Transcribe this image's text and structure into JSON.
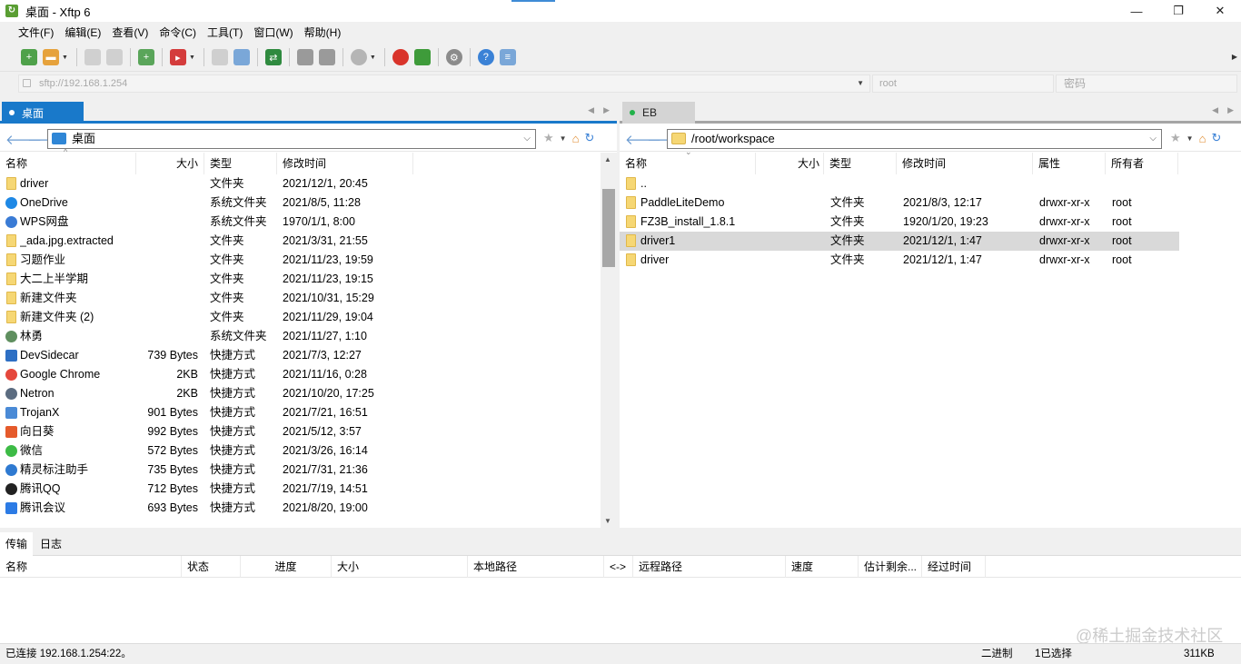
{
  "window": {
    "title": "桌面 - Xftp 6",
    "app_icon": "xftp-logo-icon"
  },
  "menu": [
    "文件(F)",
    "编辑(E)",
    "查看(V)",
    "命令(C)",
    "工具(T)",
    "窗口(W)",
    "帮助(H)"
  ],
  "address": {
    "host_placeholder": "sftp://192.168.1.254",
    "user_placeholder": "root",
    "password_placeholder": "密码"
  },
  "left": {
    "tab_label": "桌面",
    "path": "桌面",
    "columns": [
      "名称",
      "大小",
      "类型",
      "修改时间"
    ],
    "rows": [
      {
        "name": "driver",
        "size": "",
        "type": "文件夹",
        "modified": "2021/12/1, 20:45",
        "icon": "folder"
      },
      {
        "name": "OneDrive",
        "size": "",
        "type": "系统文件夹",
        "modified": "2021/8/5, 11:28",
        "icon": "cloud"
      },
      {
        "name": "WPS网盘",
        "size": "",
        "type": "系统文件夹",
        "modified": "1970/1/1, 8:00",
        "icon": "wps-cloud"
      },
      {
        "name": "_ada.jpg.extracted",
        "size": "",
        "type": "文件夹",
        "modified": "2021/3/31, 21:55",
        "icon": "folder"
      },
      {
        "name": "习题作业",
        "size": "",
        "type": "文件夹",
        "modified": "2021/11/23, 19:59",
        "icon": "folder"
      },
      {
        "name": "大二上半学期",
        "size": "",
        "type": "文件夹",
        "modified": "2021/11/23, 19:15",
        "icon": "folder"
      },
      {
        "name": "新建文件夹",
        "size": "",
        "type": "文件夹",
        "modified": "2021/10/31, 15:29",
        "icon": "folder"
      },
      {
        "name": "新建文件夹 (2)",
        "size": "",
        "type": "文件夹",
        "modified": "2021/11/29, 19:04",
        "icon": "folder"
      },
      {
        "name": "林勇",
        "size": "",
        "type": "系统文件夹",
        "modified": "2021/11/27, 1:10",
        "icon": "user"
      },
      {
        "name": "DevSidecar",
        "size": "739 Bytes",
        "type": "快捷方式",
        "modified": "2021/7/3, 12:27",
        "icon": "devsidecar"
      },
      {
        "name": "Google Chrome",
        "size": "2KB",
        "type": "快捷方式",
        "modified": "2021/11/16, 0:28",
        "icon": "chrome"
      },
      {
        "name": "Netron",
        "size": "2KB",
        "type": "快捷方式",
        "modified": "2021/10/20, 17:25",
        "icon": "netron"
      },
      {
        "name": "TrojanX",
        "size": "901 Bytes",
        "type": "快捷方式",
        "modified": "2021/7/21, 16:51",
        "icon": "trojanx"
      },
      {
        "name": "向日葵",
        "size": "992 Bytes",
        "type": "快捷方式",
        "modified": "2021/5/12, 3:57",
        "icon": "sunflower"
      },
      {
        "name": "微信",
        "size": "572 Bytes",
        "type": "快捷方式",
        "modified": "2021/3/26, 16:14",
        "icon": "wechat"
      },
      {
        "name": "精灵标注助手",
        "size": "735 Bytes",
        "type": "快捷方式",
        "modified": "2021/7/31, 21:36",
        "icon": "labeler"
      },
      {
        "name": "腾讯QQ",
        "size": "712 Bytes",
        "type": "快捷方式",
        "modified": "2021/7/19, 14:51",
        "icon": "qq"
      },
      {
        "name": "腾讯会议",
        "size": "693 Bytes",
        "type": "快捷方式",
        "modified": "2021/8/20, 19:00",
        "icon": "tencent-meeting"
      }
    ]
  },
  "right": {
    "tab_label": "EB",
    "path": "/root/workspace",
    "columns": [
      "名称",
      "大小",
      "类型",
      "修改时间",
      "属性",
      "所有者"
    ],
    "rows": [
      {
        "name": "..",
        "type": "",
        "modified": "",
        "attrs": "",
        "owner": ""
      },
      {
        "name": "PaddleLiteDemo",
        "type": "文件夹",
        "modified": "2021/8/3, 12:17",
        "attrs": "drwxr-xr-x",
        "owner": "root"
      },
      {
        "name": "FZ3B_install_1.8.1",
        "type": "文件夹",
        "modified": "1920/1/20, 19:23",
        "attrs": "drwxr-xr-x",
        "owner": "root"
      },
      {
        "name": "driver1",
        "type": "文件夹",
        "modified": "2021/12/1, 1:47",
        "attrs": "drwxr-xr-x",
        "owner": "root"
      },
      {
        "name": "driver",
        "type": "文件夹",
        "modified": "2021/12/1, 1:47",
        "attrs": "drwxr-xr-x",
        "owner": "root"
      }
    ],
    "selected_index": 3
  },
  "transfers": {
    "tabs": [
      "传输",
      "日志"
    ],
    "columns": [
      "名称",
      "状态",
      "进度",
      "大小",
      "本地路径",
      "<->",
      "远程路径",
      "速度",
      "估计剩余...",
      "经过时间"
    ]
  },
  "status": {
    "connection": "已连接 192.168.1.254:22。",
    "mode": "二进制",
    "selected": "1已选择",
    "size": "311KB"
  },
  "watermark": "@稀土掘金技术社区",
  "colors": {
    "accent": "#1979ca",
    "folder": "#f6d774",
    "selection": "#d9d9d9"
  }
}
